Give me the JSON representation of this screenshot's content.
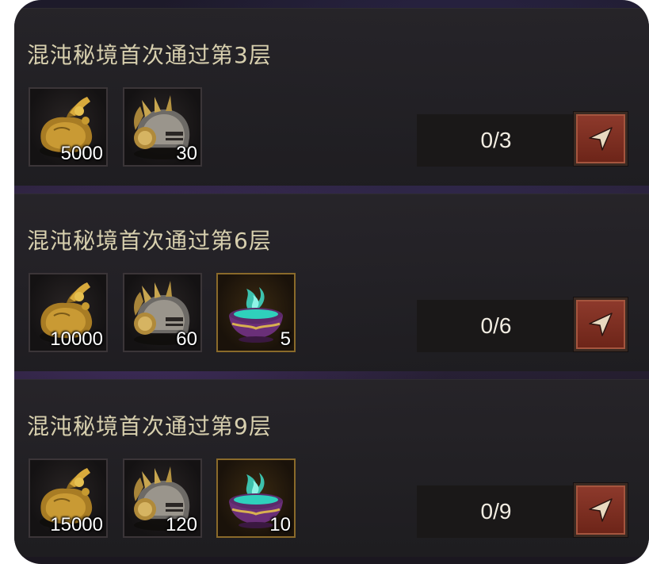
{
  "tasks": [
    {
      "title": "混沌秘境首次通过第3层",
      "progress": "0/3",
      "rewards": [
        {
          "icon": "gold-bag-icon",
          "qty": "5000"
        },
        {
          "icon": "spiked-helmet-icon",
          "qty": "30"
        }
      ]
    },
    {
      "title": "混沌秘境首次通过第6层",
      "progress": "0/6",
      "rewards": [
        {
          "icon": "gold-bag-icon",
          "qty": "10000"
        },
        {
          "icon": "spiked-helmet-icon",
          "qty": "60"
        },
        {
          "icon": "potion-cauldron-icon",
          "qty": "5"
        }
      ]
    },
    {
      "title": "混沌秘境首次通过第9层",
      "progress": "0/9",
      "rewards": [
        {
          "icon": "gold-bag-icon",
          "qty": "15000"
        },
        {
          "icon": "spiked-helmet-icon",
          "qty": "120"
        },
        {
          "icon": "potion-cauldron-icon",
          "qty": "10"
        }
      ]
    }
  ],
  "colors": {
    "title_text": "#d7cfae",
    "go_button": "#8e3a2c",
    "rare_border": "#8a6a2a"
  },
  "go_button_icon": "navigate-arrow-icon"
}
